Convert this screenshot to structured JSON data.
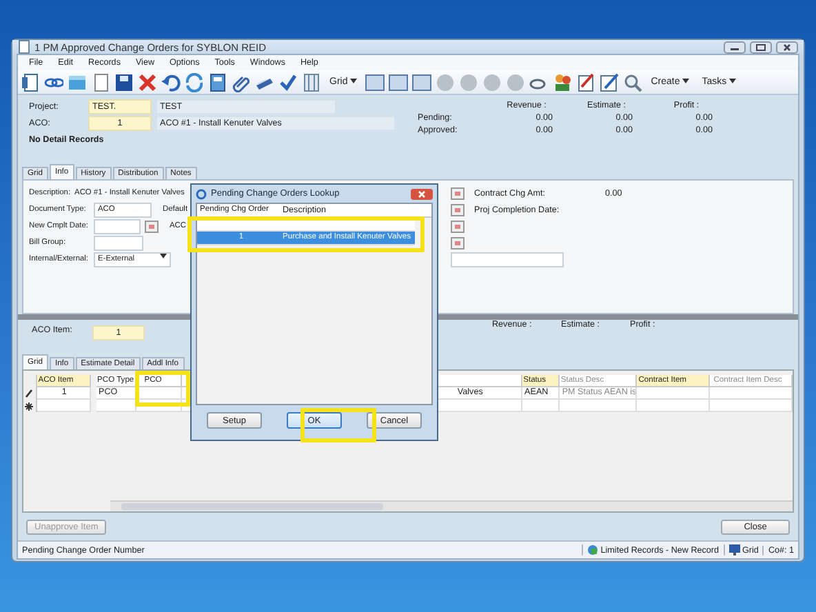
{
  "window": {
    "title": "1 PM Approved Change Orders for SYBLON REID"
  },
  "menu": [
    "File",
    "Edit",
    "Records",
    "View",
    "Options",
    "Tools",
    "Windows",
    "Help"
  ],
  "toolbar": {
    "grid_label": "Grid",
    "create_label": "Create",
    "tasks_label": "Tasks"
  },
  "header": {
    "project_label": "Project:",
    "project_code": "TEST.",
    "project_name": "TEST",
    "aco_label": "ACO:",
    "aco_number": "1",
    "aco_description": "ACO #1 - Install Kenuter Valves",
    "notice": "No Detail Records",
    "totals_columns": [
      "Revenue :",
      "Estimate :",
      "Profit :"
    ],
    "totals_rows": [
      {
        "label": "Pending:",
        "values": [
          "0.00",
          "0.00",
          "0.00"
        ]
      },
      {
        "label": "Approved:",
        "values": [
          "0.00",
          "0.00",
          "0.00"
        ]
      }
    ]
  },
  "tabs": [
    {
      "label": "Grid",
      "selected": false
    },
    {
      "label": "Info",
      "selected": true
    },
    {
      "label": "History",
      "selected": false
    },
    {
      "label": "Distribution",
      "selected": false
    },
    {
      "label": "Notes",
      "selected": false
    }
  ],
  "info": {
    "description_label": "Description:",
    "description": "ACO #1 - Install Kenuter Valves",
    "document_type_label": "Document Type:",
    "document_type": "ACO",
    "default_label": "Default",
    "new_cmplt_date_label": "New Cmplt Date:",
    "aco_label": "ACC",
    "bill_group_label": "Bill Group:",
    "internal_external_label": "Internal/External:",
    "internal_external": "E-External",
    "contract_chg_amt_label": "Contract Chg Amt:",
    "contract_chg_amt": "0.00",
    "proj_completion_label": "Proj Completion Date:"
  },
  "lower": {
    "aco_item_label": "ACO Item:",
    "aco_item": "1",
    "totals_columns": [
      "Revenue :",
      "Estimate :",
      "Profit :"
    ]
  },
  "lower_tabs": [
    {
      "label": "Grid",
      "selected": true
    },
    {
      "label": "Info",
      "selected": false
    },
    {
      "label": "Estimate Detail",
      "selected": false
    },
    {
      "label": "Addl Info",
      "selected": false
    }
  ],
  "grid": {
    "columns": [
      {
        "label": "ACO Item",
        "kind": "required"
      },
      {
        "label": "PCO Type",
        "kind": "plain"
      },
      {
        "label": "PCO",
        "kind": "plain"
      },
      {
        "kind": "hidden"
      },
      {
        "label": "Status",
        "kind": "required"
      },
      {
        "label": "Status Desc",
        "kind": "readonly"
      },
      {
        "label": "Contract Item",
        "kind": "required"
      },
      {
        "label": "Contract Item Desc",
        "kind": "readonly"
      }
    ],
    "rows": [
      {
        "kind": "editing",
        "cells": [
          "1",
          "PCO",
          "",
          "Valves",
          "AEAN",
          "PM Status AEAN is",
          "",
          ""
        ]
      },
      {
        "kind": "new",
        "cells": [
          "",
          "",
          "",
          "",
          "",
          "",
          "",
          ""
        ]
      }
    ]
  },
  "buttons": {
    "unapprove": {
      "label": "Unapprove Item",
      "disabled": true
    },
    "close": "Close"
  },
  "status_bar": {
    "message": "Pending Change Order Number",
    "mode": "Limited Records - New Record",
    "view": "Grid",
    "company": "Co#: 1"
  },
  "dialog": {
    "title": "Pending Change Orders Lookup",
    "columns": [
      "Pending Chg Order",
      "Description"
    ],
    "rows": [
      {
        "number": "",
        "description": "",
        "selected": false
      },
      {
        "number": "1",
        "description": "Purchase and Install Kenuter Valves",
        "selected": true
      }
    ],
    "buttons": [
      "Setup",
      "OK",
      "Cancel"
    ]
  }
}
